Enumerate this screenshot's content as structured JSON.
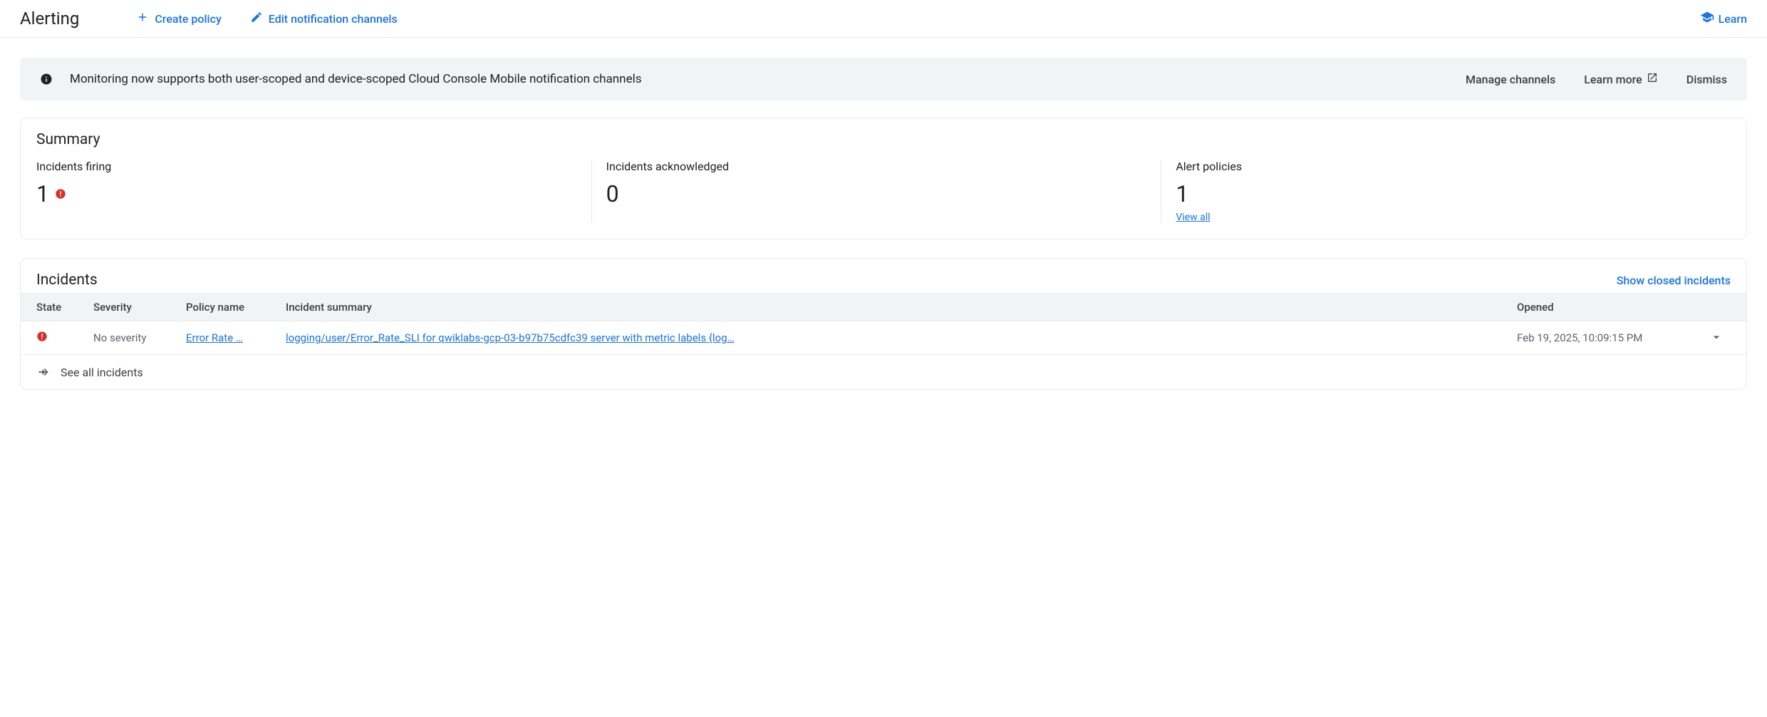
{
  "header": {
    "title": "Alerting",
    "create_policy": "Create policy",
    "edit_channels": "Edit notification channels",
    "learn": "Learn"
  },
  "banner": {
    "message": "Monitoring now supports both user-scoped and device-scoped Cloud Console Mobile notification channels",
    "manage": "Manage channels",
    "learn_more": "Learn more",
    "dismiss": "Dismiss"
  },
  "summary": {
    "title": "Summary",
    "firing": {
      "label": "Incidents firing",
      "value": "1"
    },
    "acknowledged": {
      "label": "Incidents acknowledged",
      "value": "0"
    },
    "policies": {
      "label": "Alert policies",
      "value": "1",
      "view_all": "View all"
    }
  },
  "incidents": {
    "title": "Incidents",
    "show_closed": "Show closed incidents",
    "columns": {
      "state": "State",
      "severity": "Severity",
      "policy": "Policy name",
      "summary": "Incident summary",
      "opened": "Opened"
    },
    "rows": [
      {
        "severity": "No severity",
        "policy": "Error Rate …",
        "summary": "logging/user/Error_Rate_SLI for qwiklabs-gcp-03-b97b75cdfc39 server with metric labels {log…",
        "opened": "Feb 19, 2025, 10:09:15 PM"
      }
    ],
    "see_all": "See all incidents"
  }
}
